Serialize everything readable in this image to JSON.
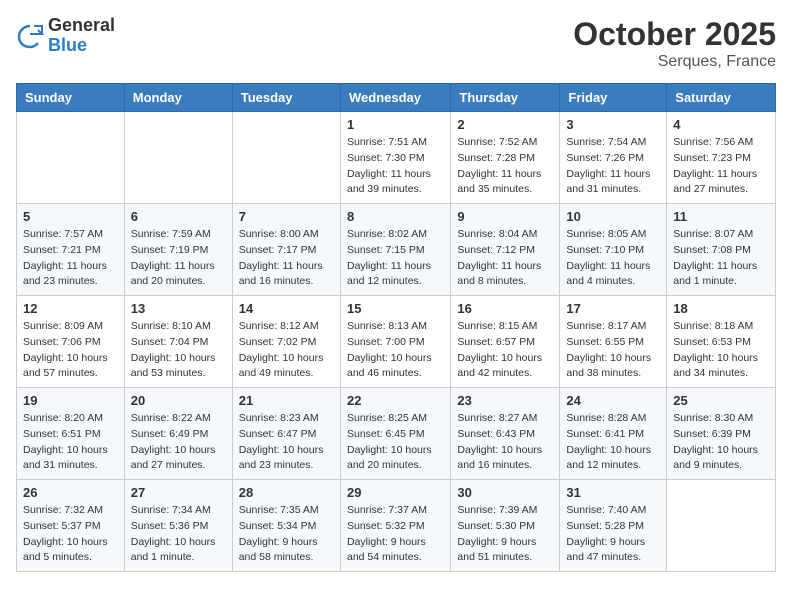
{
  "header": {
    "logo": {
      "general": "General",
      "blue": "Blue"
    },
    "title": "October 2025",
    "location": "Serques, France"
  },
  "days_of_week": [
    "Sunday",
    "Monday",
    "Tuesday",
    "Wednesday",
    "Thursday",
    "Friday",
    "Saturday"
  ],
  "weeks": [
    {
      "cells": [
        {
          "day": "",
          "info": ""
        },
        {
          "day": "",
          "info": ""
        },
        {
          "day": "",
          "info": ""
        },
        {
          "day": "1",
          "info": "Sunrise: 7:51 AM\nSunset: 7:30 PM\nDaylight: 11 hours and 39 minutes."
        },
        {
          "day": "2",
          "info": "Sunrise: 7:52 AM\nSunset: 7:28 PM\nDaylight: 11 hours and 35 minutes."
        },
        {
          "day": "3",
          "info": "Sunrise: 7:54 AM\nSunset: 7:26 PM\nDaylight: 11 hours and 31 minutes."
        },
        {
          "day": "4",
          "info": "Sunrise: 7:56 AM\nSunset: 7:23 PM\nDaylight: 11 hours and 27 minutes."
        }
      ]
    },
    {
      "cells": [
        {
          "day": "5",
          "info": "Sunrise: 7:57 AM\nSunset: 7:21 PM\nDaylight: 11 hours and 23 minutes."
        },
        {
          "day": "6",
          "info": "Sunrise: 7:59 AM\nSunset: 7:19 PM\nDaylight: 11 hours and 20 minutes."
        },
        {
          "day": "7",
          "info": "Sunrise: 8:00 AM\nSunset: 7:17 PM\nDaylight: 11 hours and 16 minutes."
        },
        {
          "day": "8",
          "info": "Sunrise: 8:02 AM\nSunset: 7:15 PM\nDaylight: 11 hours and 12 minutes."
        },
        {
          "day": "9",
          "info": "Sunrise: 8:04 AM\nSunset: 7:12 PM\nDaylight: 11 hours and 8 minutes."
        },
        {
          "day": "10",
          "info": "Sunrise: 8:05 AM\nSunset: 7:10 PM\nDaylight: 11 hours and 4 minutes."
        },
        {
          "day": "11",
          "info": "Sunrise: 8:07 AM\nSunset: 7:08 PM\nDaylight: 11 hours and 1 minute."
        }
      ]
    },
    {
      "cells": [
        {
          "day": "12",
          "info": "Sunrise: 8:09 AM\nSunset: 7:06 PM\nDaylight: 10 hours and 57 minutes."
        },
        {
          "day": "13",
          "info": "Sunrise: 8:10 AM\nSunset: 7:04 PM\nDaylight: 10 hours and 53 minutes."
        },
        {
          "day": "14",
          "info": "Sunrise: 8:12 AM\nSunset: 7:02 PM\nDaylight: 10 hours and 49 minutes."
        },
        {
          "day": "15",
          "info": "Sunrise: 8:13 AM\nSunset: 7:00 PM\nDaylight: 10 hours and 46 minutes."
        },
        {
          "day": "16",
          "info": "Sunrise: 8:15 AM\nSunset: 6:57 PM\nDaylight: 10 hours and 42 minutes."
        },
        {
          "day": "17",
          "info": "Sunrise: 8:17 AM\nSunset: 6:55 PM\nDaylight: 10 hours and 38 minutes."
        },
        {
          "day": "18",
          "info": "Sunrise: 8:18 AM\nSunset: 6:53 PM\nDaylight: 10 hours and 34 minutes."
        }
      ]
    },
    {
      "cells": [
        {
          "day": "19",
          "info": "Sunrise: 8:20 AM\nSunset: 6:51 PM\nDaylight: 10 hours and 31 minutes."
        },
        {
          "day": "20",
          "info": "Sunrise: 8:22 AM\nSunset: 6:49 PM\nDaylight: 10 hours and 27 minutes."
        },
        {
          "day": "21",
          "info": "Sunrise: 8:23 AM\nSunset: 6:47 PM\nDaylight: 10 hours and 23 minutes."
        },
        {
          "day": "22",
          "info": "Sunrise: 8:25 AM\nSunset: 6:45 PM\nDaylight: 10 hours and 20 minutes."
        },
        {
          "day": "23",
          "info": "Sunrise: 8:27 AM\nSunset: 6:43 PM\nDaylight: 10 hours and 16 minutes."
        },
        {
          "day": "24",
          "info": "Sunrise: 8:28 AM\nSunset: 6:41 PM\nDaylight: 10 hours and 12 minutes."
        },
        {
          "day": "25",
          "info": "Sunrise: 8:30 AM\nSunset: 6:39 PM\nDaylight: 10 hours and 9 minutes."
        }
      ]
    },
    {
      "cells": [
        {
          "day": "26",
          "info": "Sunrise: 7:32 AM\nSunset: 5:37 PM\nDaylight: 10 hours and 5 minutes."
        },
        {
          "day": "27",
          "info": "Sunrise: 7:34 AM\nSunset: 5:36 PM\nDaylight: 10 hours and 1 minute."
        },
        {
          "day": "28",
          "info": "Sunrise: 7:35 AM\nSunset: 5:34 PM\nDaylight: 9 hours and 58 minutes."
        },
        {
          "day": "29",
          "info": "Sunrise: 7:37 AM\nSunset: 5:32 PM\nDaylight: 9 hours and 54 minutes."
        },
        {
          "day": "30",
          "info": "Sunrise: 7:39 AM\nSunset: 5:30 PM\nDaylight: 9 hours and 51 minutes."
        },
        {
          "day": "31",
          "info": "Sunrise: 7:40 AM\nSunset: 5:28 PM\nDaylight: 9 hours and 47 minutes."
        },
        {
          "day": "",
          "info": ""
        }
      ]
    }
  ]
}
